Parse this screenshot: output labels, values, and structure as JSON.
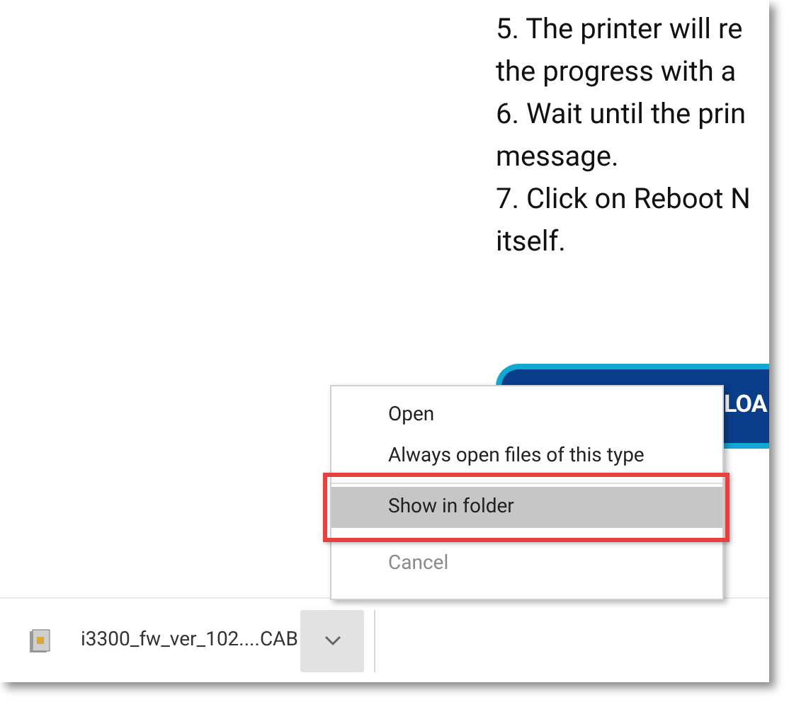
{
  "article": {
    "lines": [
      "5. The printer will re",
      "the progress with a",
      "6. Wait until the prin",
      "message.",
      "7. Click on Reboot N",
      "itself."
    ]
  },
  "download_button": {
    "label": "LOA"
  },
  "context_menu": {
    "groups": [
      [
        {
          "label": "Open",
          "selected": false,
          "disabled": false
        },
        {
          "label": "Always open files of this type",
          "selected": false,
          "disabled": false
        }
      ],
      [
        {
          "label": "Show in folder",
          "selected": true,
          "disabled": false
        }
      ],
      [
        {
          "label": "Cancel",
          "selected": false,
          "disabled": true
        }
      ]
    ]
  },
  "download_bar": {
    "file_name": "i3300_fw_ver_102....CAB"
  }
}
